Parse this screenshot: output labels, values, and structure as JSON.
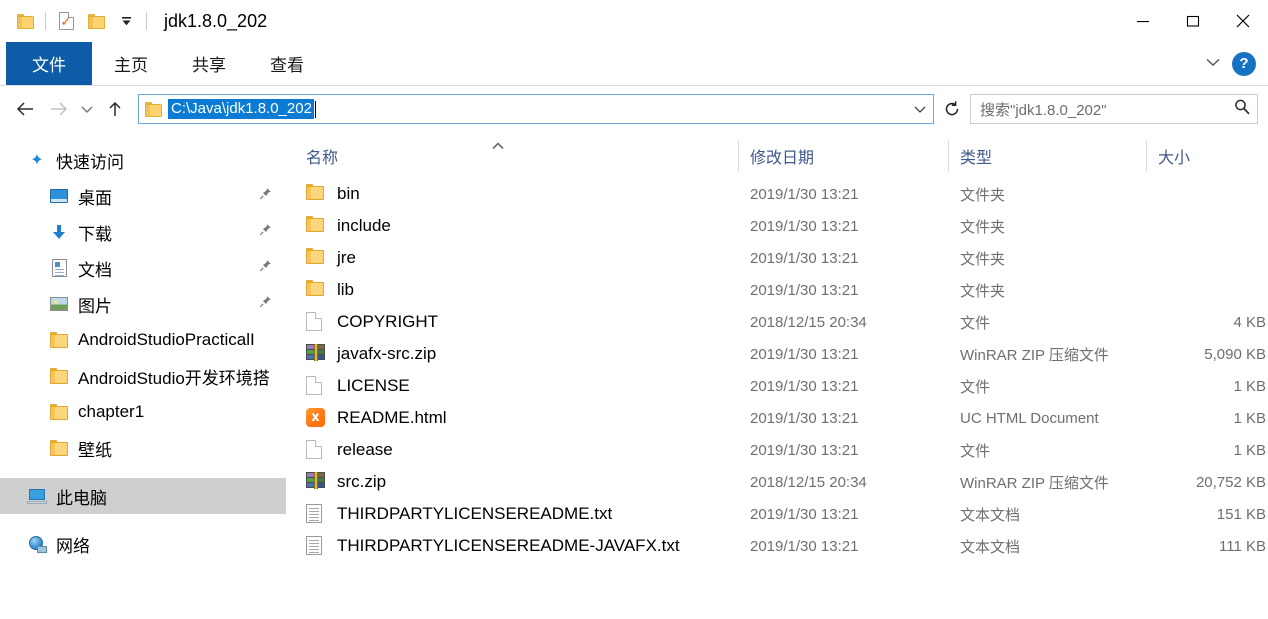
{
  "window": {
    "title": "jdk1.8.0_202",
    "quick_access": [
      {
        "name": "folder-icon",
        "label": "文件夹"
      },
      {
        "name": "properties-icon",
        "label": "属性"
      },
      {
        "name": "new-folder-icon",
        "label": "新建文件夹"
      },
      {
        "name": "customize-dropdown-icon",
        "label": "自定义快速访问工具栏"
      }
    ],
    "controls": {
      "minimize": "最小化",
      "maximize": "最大化",
      "close": "关闭"
    }
  },
  "ribbon": {
    "tabs": [
      {
        "label": "文件",
        "active": true
      },
      {
        "label": "主页",
        "active": false
      },
      {
        "label": "共享",
        "active": false
      },
      {
        "label": "查看",
        "active": false
      }
    ],
    "expand_label": "展开功能区",
    "help_label": "?"
  },
  "navigation": {
    "back_label": "后退",
    "forward_label": "前进",
    "recent_label": "最近浏览的位置",
    "up_label": "上移到",
    "address": {
      "value": "C:\\Java\\jdk1.8.0_202",
      "selected": true,
      "dropdown_label": "以前的位置"
    },
    "refresh_label": "刷新",
    "search": {
      "placeholder": "搜索\"jdk1.8.0_202\"",
      "icon": "search-icon"
    }
  },
  "sidebar": {
    "items": [
      {
        "label": "快速访问",
        "icon": "star-icon",
        "level": 0,
        "pinned": false,
        "selected": false
      },
      {
        "label": "桌面",
        "icon": "desktop-icon",
        "level": 1,
        "pinned": true,
        "selected": false
      },
      {
        "label": "下载",
        "icon": "download-icon",
        "level": 1,
        "pinned": true,
        "selected": false
      },
      {
        "label": "文档",
        "icon": "documents-icon",
        "level": 1,
        "pinned": true,
        "selected": false
      },
      {
        "label": "图片",
        "icon": "pictures-icon",
        "level": 1,
        "pinned": true,
        "selected": false
      },
      {
        "label": "AndroidStudioPracticalI",
        "icon": "folder-icon",
        "level": 1,
        "pinned": false,
        "selected": false
      },
      {
        "label": "AndroidStudio开发环境搭",
        "icon": "folder-icon",
        "level": 1,
        "pinned": false,
        "selected": false
      },
      {
        "label": "chapter1",
        "icon": "folder-icon",
        "level": 1,
        "pinned": false,
        "selected": false
      },
      {
        "label": "壁纸",
        "icon": "folder-icon",
        "level": 1,
        "pinned": false,
        "selected": false
      },
      {
        "label": "此电脑",
        "icon": "this-pc-icon",
        "level": 0,
        "pinned": false,
        "selected": true
      },
      {
        "label": "网络",
        "icon": "network-icon",
        "level": 0,
        "pinned": false,
        "selected": false
      }
    ]
  },
  "filelist": {
    "columns": [
      {
        "label": "名称",
        "sort": "asc"
      },
      {
        "label": "修改日期",
        "sort": null
      },
      {
        "label": "类型",
        "sort": null
      },
      {
        "label": "大小",
        "sort": null
      }
    ],
    "rows": [
      {
        "name": "bin",
        "icon": "folder-icon",
        "date": "2019/1/30 13:21",
        "type": "文件夹",
        "size": ""
      },
      {
        "name": "include",
        "icon": "folder-icon",
        "date": "2019/1/30 13:21",
        "type": "文件夹",
        "size": ""
      },
      {
        "name": "jre",
        "icon": "folder-icon",
        "date": "2019/1/30 13:21",
        "type": "文件夹",
        "size": ""
      },
      {
        "name": "lib",
        "icon": "folder-icon",
        "date": "2019/1/30 13:21",
        "type": "文件夹",
        "size": ""
      },
      {
        "name": "COPYRIGHT",
        "icon": "file-icon",
        "date": "2018/12/15 20:34",
        "type": "文件",
        "size": "4 KB"
      },
      {
        "name": "javafx-src.zip",
        "icon": "winrar-zip-icon",
        "date": "2019/1/30 13:21",
        "type": "WinRAR ZIP 压缩文件",
        "size": "5,090 KB"
      },
      {
        "name": "LICENSE",
        "icon": "file-icon",
        "date": "2019/1/30 13:21",
        "type": "文件",
        "size": "1 KB"
      },
      {
        "name": "README.html",
        "icon": "uc-html-icon",
        "date": "2019/1/30 13:21",
        "type": "UC HTML Document",
        "size": "1 KB"
      },
      {
        "name": "release",
        "icon": "file-icon",
        "date": "2019/1/30 13:21",
        "type": "文件",
        "size": "1 KB"
      },
      {
        "name": "src.zip",
        "icon": "winrar-zip-icon",
        "date": "2018/12/15 20:34",
        "type": "WinRAR ZIP 压缩文件",
        "size": "20,752 KB"
      },
      {
        "name": "THIRDPARTYLICENSEREADME.txt",
        "icon": "text-document-icon",
        "date": "2019/1/30 13:21",
        "type": "文本文档",
        "size": "151 KB"
      },
      {
        "name": "THIRDPARTYLICENSEREADME-JAVAFX.txt",
        "icon": "text-document-icon",
        "date": "2019/1/30 13:21",
        "type": "文本文档",
        "size": "111 KB"
      }
    ]
  },
  "colors": {
    "accent": "#0e5ca8",
    "selection": "#0b7bd4",
    "header_text": "#41598a",
    "sidebar_selected": "#cfcfcf"
  }
}
